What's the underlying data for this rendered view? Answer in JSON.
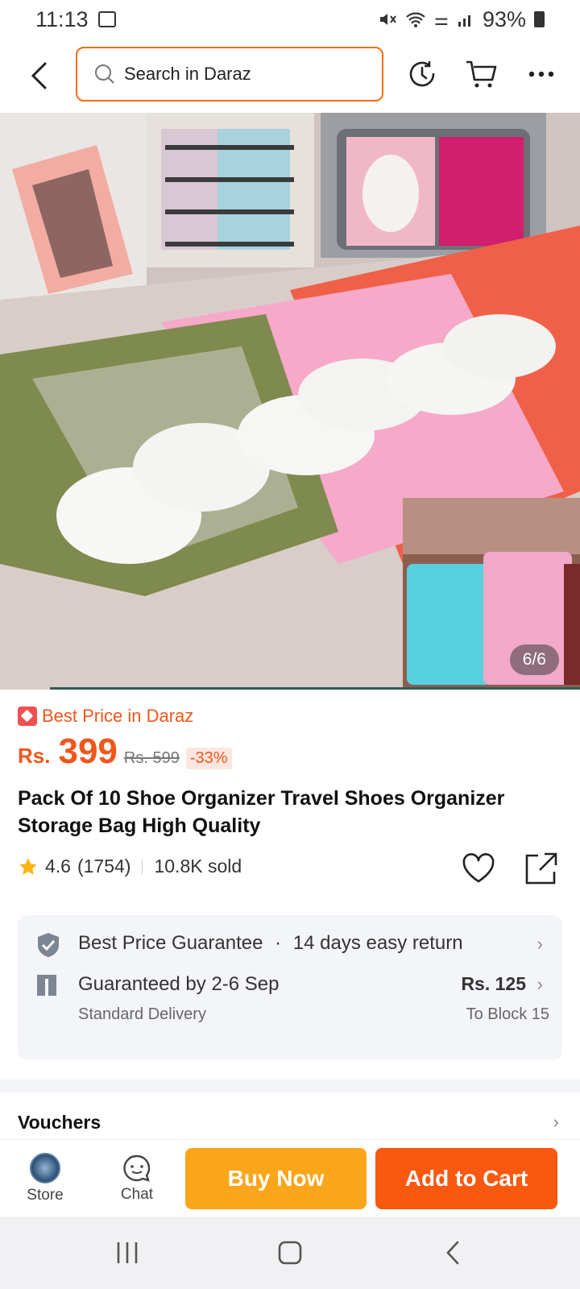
{
  "status_bar": {
    "time": "11:13",
    "battery": "93%"
  },
  "search": {
    "placeholder": "Search in Daraz"
  },
  "gallery": {
    "counter": "6/6"
  },
  "product": {
    "badge": "Best Price in Daraz",
    "currency": "Rs.",
    "price": "399",
    "old_price": "Rs. 599",
    "discount": "-33%",
    "title": "Pack Of 10 Shoe Organizer Travel Shoes Organizer Storage Bag High Quality",
    "rating": "4.6",
    "rating_count": "(1754)",
    "sold": "10.8K sold"
  },
  "service": {
    "guarantee": "Best Price Guarantee",
    "dot": "·",
    "returns": "14 days easy return",
    "delivery_title": "Guaranteed by 2-6 Sep",
    "delivery_type": "Standard Delivery",
    "fee": "Rs. 125",
    "destination": "To Block 15"
  },
  "vouchers": {
    "label": "Vouchers"
  },
  "action_bar": {
    "store_label": "Store",
    "chat_label": "Chat",
    "buy_now": "Buy Now",
    "add_to_cart": "Add to Cart"
  },
  "colors": {
    "accent": "#f1561a",
    "buy_now": "#fba51b",
    "add_to_cart": "#f85810"
  }
}
